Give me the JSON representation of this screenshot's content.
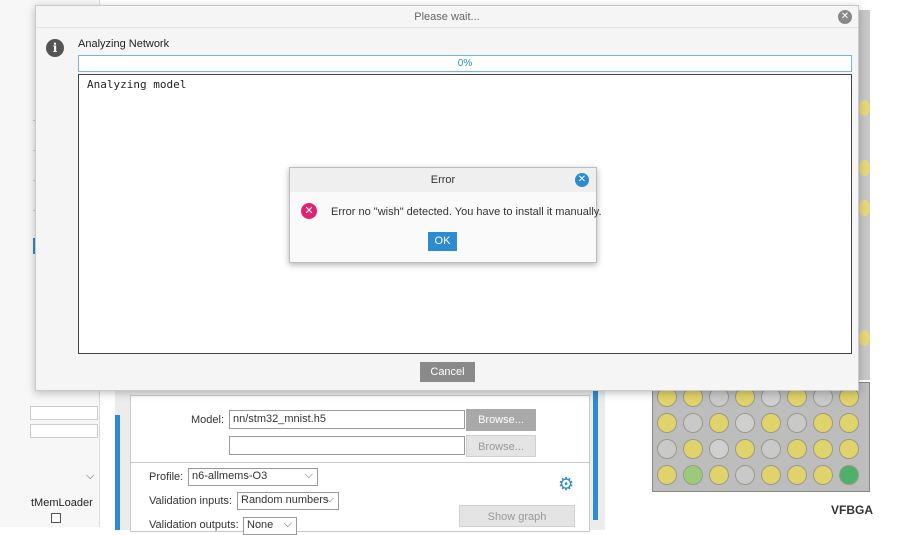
{
  "wait_dialog": {
    "title": "Please wait...",
    "status": "Analyzing Network",
    "progress": {
      "percent": 0,
      "label": "0%"
    },
    "log_text": "Analyzing model",
    "cancel_label": "Cancel"
  },
  "error_dialog": {
    "title": "Error",
    "message": "Error no \"wish\" detected. You have to install it manually.",
    "ok_label": "OK"
  },
  "background": {
    "left_panel": {
      "loader_label": "tMemLoader"
    },
    "model": {
      "label": "Model:",
      "value": "nn/stm32_mnist.h5",
      "browse_label": "Browse...",
      "browse2_label": "Browse..."
    },
    "profile": {
      "label": "Profile:",
      "value": "n6-allmems-O3"
    },
    "validation_inputs": {
      "label": "Validation inputs:",
      "value": "Random numbers"
    },
    "validation_outputs": {
      "label": "Validation outputs:",
      "value": "None"
    },
    "show_graph_label": "Show graph",
    "package_label": "VFBGA"
  },
  "colors": {
    "accent": "#2d8bd1",
    "error": "#e2226e",
    "cancel_button": "#8a8a8a"
  }
}
